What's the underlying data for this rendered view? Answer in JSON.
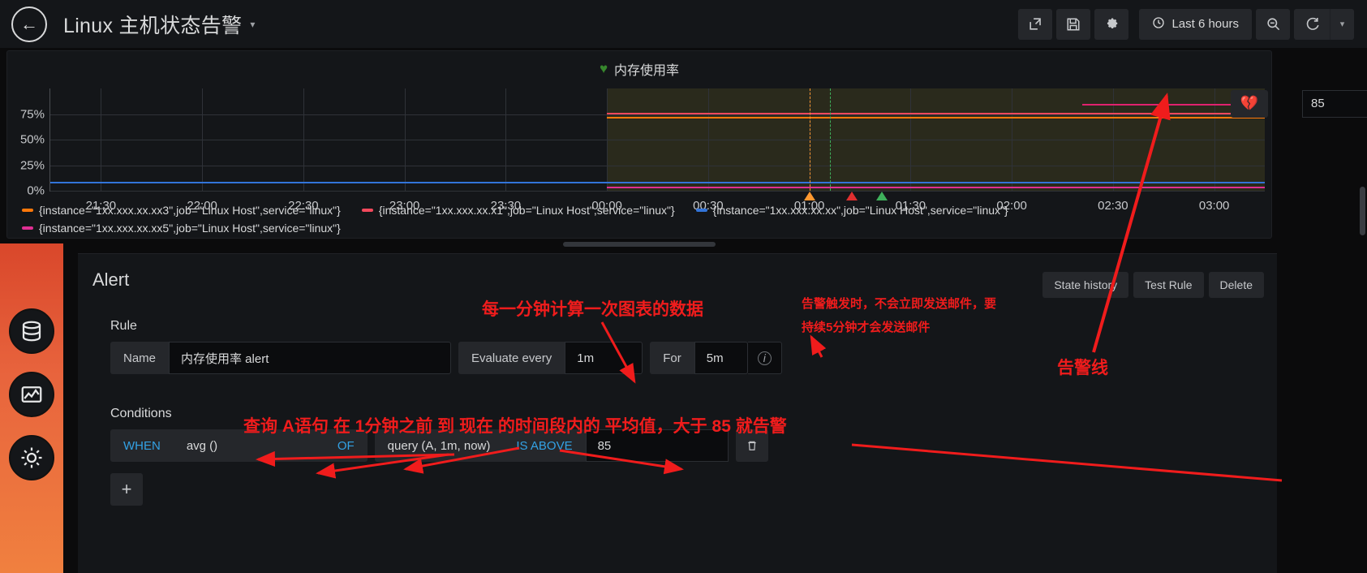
{
  "topnav": {
    "back_icon": "arrow-left-circle-icon",
    "dashboard_title": "Linux 主机状态告警",
    "title_caret": "▾",
    "share_icon": "share-icon",
    "save_icon": "save-icon",
    "settings_icon": "gear-icon",
    "clock_icon": "clock-icon",
    "time_range": "Last 6 hours",
    "zoom_out_icon": "search-minus-icon",
    "refresh_icon": "refresh-icon",
    "refresh_caret": "▾"
  },
  "rail": {
    "items": [
      {
        "name": "database-icon",
        "glyph": "▤"
      },
      {
        "name": "dashboard-graph-icon",
        "glyph": "◩"
      },
      {
        "name": "gear-alert-icon",
        "glyph": "✷"
      }
    ]
  },
  "panel": {
    "heart_icon": "heart-ok-icon",
    "title": "内存使用率",
    "threshold_heart_icon": "heart-break-icon",
    "threshold_value": "85",
    "resize_handle": "panel-resize-handle"
  },
  "chart_data": {
    "type": "line",
    "title": "内存使用率",
    "xlabel": "",
    "ylabel": "",
    "ylim": [
      0,
      100
    ],
    "yticks": [
      "0%",
      "25%",
      "50%",
      "75%"
    ],
    "ytick_values": [
      0,
      25,
      50,
      75
    ],
    "grid": true,
    "legend_position": "bottom",
    "xticks": [
      "21:30",
      "22:00",
      "22:30",
      "23:00",
      "23:30",
      "00:00",
      "00:30",
      "01:00",
      "01:30",
      "02:00",
      "02:30",
      "03:00"
    ],
    "threshold": {
      "value": 85,
      "label": "85",
      "op": "gt",
      "color": "#e0226e"
    },
    "alert_region": {
      "start": "00:00",
      "end": "03:10",
      "color": "rgba(130,125,40,0.20)"
    },
    "series": [
      {
        "name": "{instance=\"1xx.xxx.xx.xx3\",job=\"Linux Host\",service=\"linux\"}",
        "color": "#ff780a",
        "level": 72,
        "segment": "right"
      },
      {
        "name": "{instance=\"1xx.xxx.xx.x1\",job=\"Linux Host\",service=\"linux\"}",
        "color": "#f2495c",
        "level": 76,
        "segment": "right"
      },
      {
        "name": "{instance=\"1xx.xxx.xx.xx\",job=\"Linux Host\",service=\"linux\"}",
        "color": "#3274d9",
        "level": 9,
        "segment": "full"
      },
      {
        "name": "{instance=\"1xx.xxx.xx.xx5\",job=\"Linux Host\",service=\"linux\"}",
        "color": "#e02f93",
        "level": 4,
        "segment": "right"
      }
    ],
    "state_markers": [
      {
        "time": "01:00",
        "state": "pending",
        "color": "#ff9830"
      },
      {
        "time": "01:07",
        "state": "alerting",
        "color": "#e02f2f"
      },
      {
        "time": "01:12",
        "state": "ok",
        "color": "#3eb15b"
      }
    ],
    "event_lines": [
      {
        "time": "01:00",
        "color": "#ff9830"
      },
      {
        "time": "01:12",
        "color": "#3eb15b"
      }
    ]
  },
  "legend": [
    {
      "color": "#ff780a",
      "label": "{instance=\"1xx.xxx.xx.xx3\",job=\"Linux Host\",service=\"linux\"}"
    },
    {
      "color": "#f2495c",
      "label": "{instance=\"1xx.xxx.xx.x1\",job=\"Linux Host\",service=\"linux\"}"
    },
    {
      "color": "#3274d9",
      "label": "{instance=\"1xx.xxx.xx.xx\",job=\"Linux Host\",service=\"linux\"}"
    },
    {
      "color": "#e02f93",
      "label": "{instance=\"1xx.xxx.xx.xx5\",job=\"Linux Host\",service=\"linux\"}"
    }
  ],
  "alert_editor": {
    "title": "Alert",
    "actions": {
      "state_history": "State history",
      "test_rule": "Test Rule",
      "delete": "Delete"
    },
    "rule": {
      "section_label": "Rule",
      "name_label": "Name",
      "name_value": "内存使用率 alert",
      "evaluate_label": "Evaluate every",
      "evaluate_value": "1m",
      "for_label": "For",
      "for_value": "5m",
      "info_icon": "info-icon"
    },
    "conditions": {
      "section_label": "Conditions",
      "when": "WHEN",
      "reducer": "avg ()",
      "of": "OF",
      "query": "query (A, 1m, now)",
      "operator": "IS ABOVE",
      "value": "85",
      "delete_icon": "trash-icon",
      "add_icon": "plus-icon"
    }
  },
  "annotations": [
    {
      "id": "anno-evaluate",
      "text": "每一分钟计算一次图表的数据"
    },
    {
      "id": "anno-for-line1",
      "text": "告警触发时，不会立即发送邮件，要"
    },
    {
      "id": "anno-for-line2",
      "text": "持续5分钟才会发送邮件"
    },
    {
      "id": "anno-condition",
      "text": "查询 A语句 在 1分钟之前 到 现在 的时间段内的 平均值，大于 85 就告警"
    },
    {
      "id": "anno-threshold",
      "text": "告警线"
    }
  ]
}
